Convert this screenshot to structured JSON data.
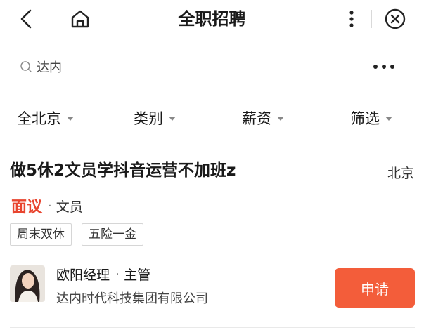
{
  "header": {
    "title": "全职招聘",
    "icons": [
      "back-icon",
      "home-icon",
      "more-vertical-icon",
      "close-circle-icon"
    ]
  },
  "search": {
    "value": "达内",
    "icon": "search-icon",
    "more_icon": "more-horizontal-icon"
  },
  "filters": [
    {
      "label": "全北京"
    },
    {
      "label": "类别"
    },
    {
      "label": "薪资"
    },
    {
      "label": "筛选"
    }
  ],
  "job": {
    "title": "做5休2文员学抖音运营不加班z",
    "city": "北京",
    "salary": "面议",
    "separator": "·",
    "category": "文员",
    "tags": [
      "周末双休",
      "五险一金"
    ],
    "recruiter": {
      "name": "欧阳经理",
      "separator": "·",
      "role": "主管",
      "company": "达内时代科技集团有限公司"
    },
    "apply_label": "申请"
  },
  "colors": {
    "accent": "#f35d3a",
    "salary": "#e8452f"
  }
}
